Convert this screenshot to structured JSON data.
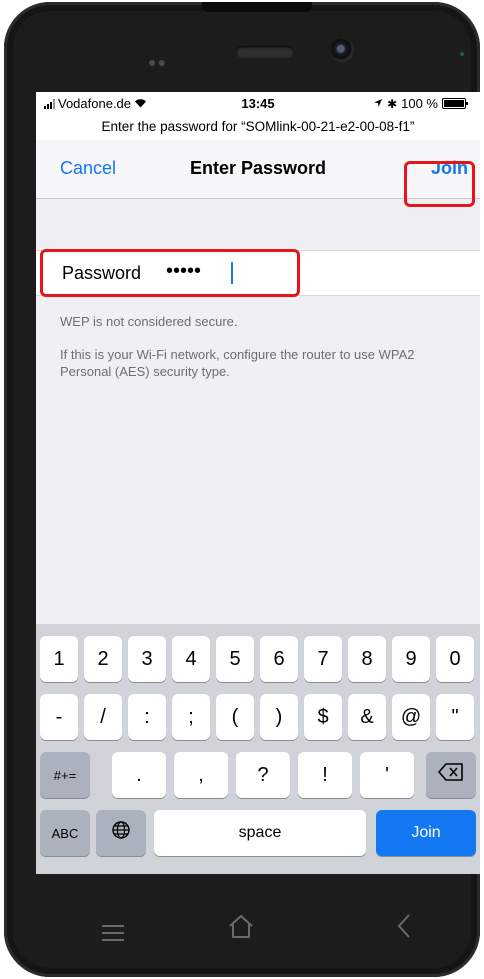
{
  "status": {
    "carrier": "Vodafone.de",
    "time": "13:45",
    "battery": "100 %"
  },
  "prompt": "Enter the password for “SOMlink-00-21-e2-00-08-f1”",
  "nav": {
    "cancel": "Cancel",
    "title": "Enter Password",
    "join": "Join"
  },
  "password": {
    "label": "Password",
    "masked": "•••••"
  },
  "notes": {
    "wep": "WEP is not considered secure.",
    "help": "If this is your Wi-Fi network, configure the router to use WPA2 Personal (AES) security type."
  },
  "keyboard": {
    "row1": [
      "1",
      "2",
      "3",
      "4",
      "5",
      "6",
      "7",
      "8",
      "9",
      "0"
    ],
    "row2": [
      "-",
      "/",
      ":",
      ";",
      "(",
      ")",
      "$",
      "&",
      "@",
      "\""
    ],
    "row3": [
      ".",
      ",",
      "?",
      "!",
      "'"
    ],
    "symbols": "#+=",
    "abc": "ABC",
    "space": "space",
    "join": "Join"
  },
  "highlight_color": "#e4161c",
  "accent_color": "#1577e8"
}
